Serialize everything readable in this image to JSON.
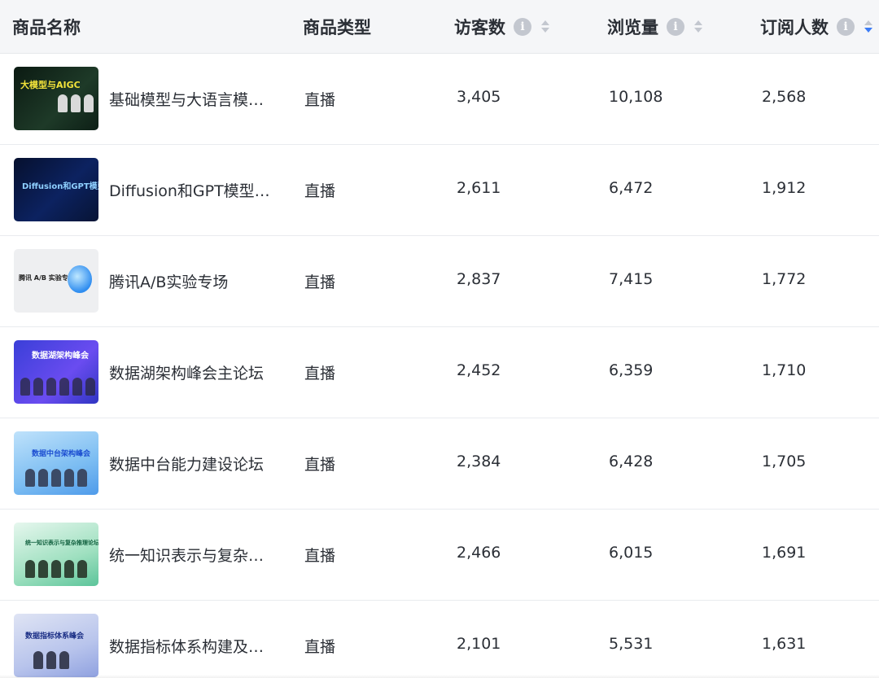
{
  "headers": {
    "name": "商品名称",
    "type": "商品类型",
    "visitors": "访客数",
    "views": "浏览量",
    "subscribers": "订阅人数"
  },
  "colors": {
    "header_bg": "#f5f6f8",
    "sort_active": "#3b7cf6",
    "icon_gray": "#c3c7cf"
  },
  "rows": [
    {
      "name": "基础模型与大语言模…",
      "type": "直播",
      "visitors": "3,405",
      "views": "10,108",
      "subscribers": "2,568",
      "thumb_text": "大模型与AIGC"
    },
    {
      "name": "Diffusion和GPT模型…",
      "type": "直播",
      "visitors": "2,611",
      "views": "6,472",
      "subscribers": "1,912",
      "thumb_text": "Diffusion和GPT模型"
    },
    {
      "name": "腾讯A/B实验专场",
      "type": "直播",
      "visitors": "2,837",
      "views": "7,415",
      "subscribers": "1,772",
      "thumb_text": "腾讯 A/B 实验专场"
    },
    {
      "name": "数据湖架构峰会主论坛",
      "type": "直播",
      "visitors": "2,452",
      "views": "6,359",
      "subscribers": "1,710",
      "thumb_text": "数据湖架构峰会"
    },
    {
      "name": "数据中台能力建设论坛",
      "type": "直播",
      "visitors": "2,384",
      "views": "6,428",
      "subscribers": "1,705",
      "thumb_text": "数据中台架构峰会"
    },
    {
      "name": "统一知识表示与复杂…",
      "type": "直播",
      "visitors": "2,466",
      "views": "6,015",
      "subscribers": "1,691",
      "thumb_text": "统一知识表示与复杂推理论坛"
    },
    {
      "name": "数据指标体系构建及…",
      "type": "直播",
      "visitors": "2,101",
      "views": "5,531",
      "subscribers": "1,631",
      "thumb_text": "数据指标体系峰会"
    }
  ]
}
